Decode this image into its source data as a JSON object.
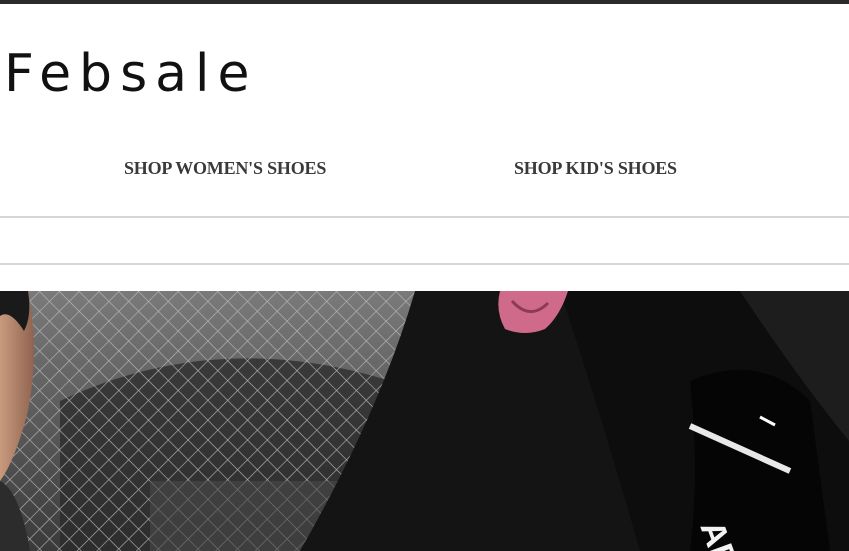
{
  "brand": {
    "logo_text": "Febsale"
  },
  "nav": {
    "items": [
      {
        "label": "SHOP WOMEN'S SHOES"
      },
      {
        "label": "SHOP KID'S SHOES"
      }
    ]
  },
  "hero": {
    "sock_text": "AF"
  },
  "colors": {
    "top_bar": "#2b2b2b",
    "nav_text": "#3a3a3a",
    "divider": "#d6d6d6"
  }
}
